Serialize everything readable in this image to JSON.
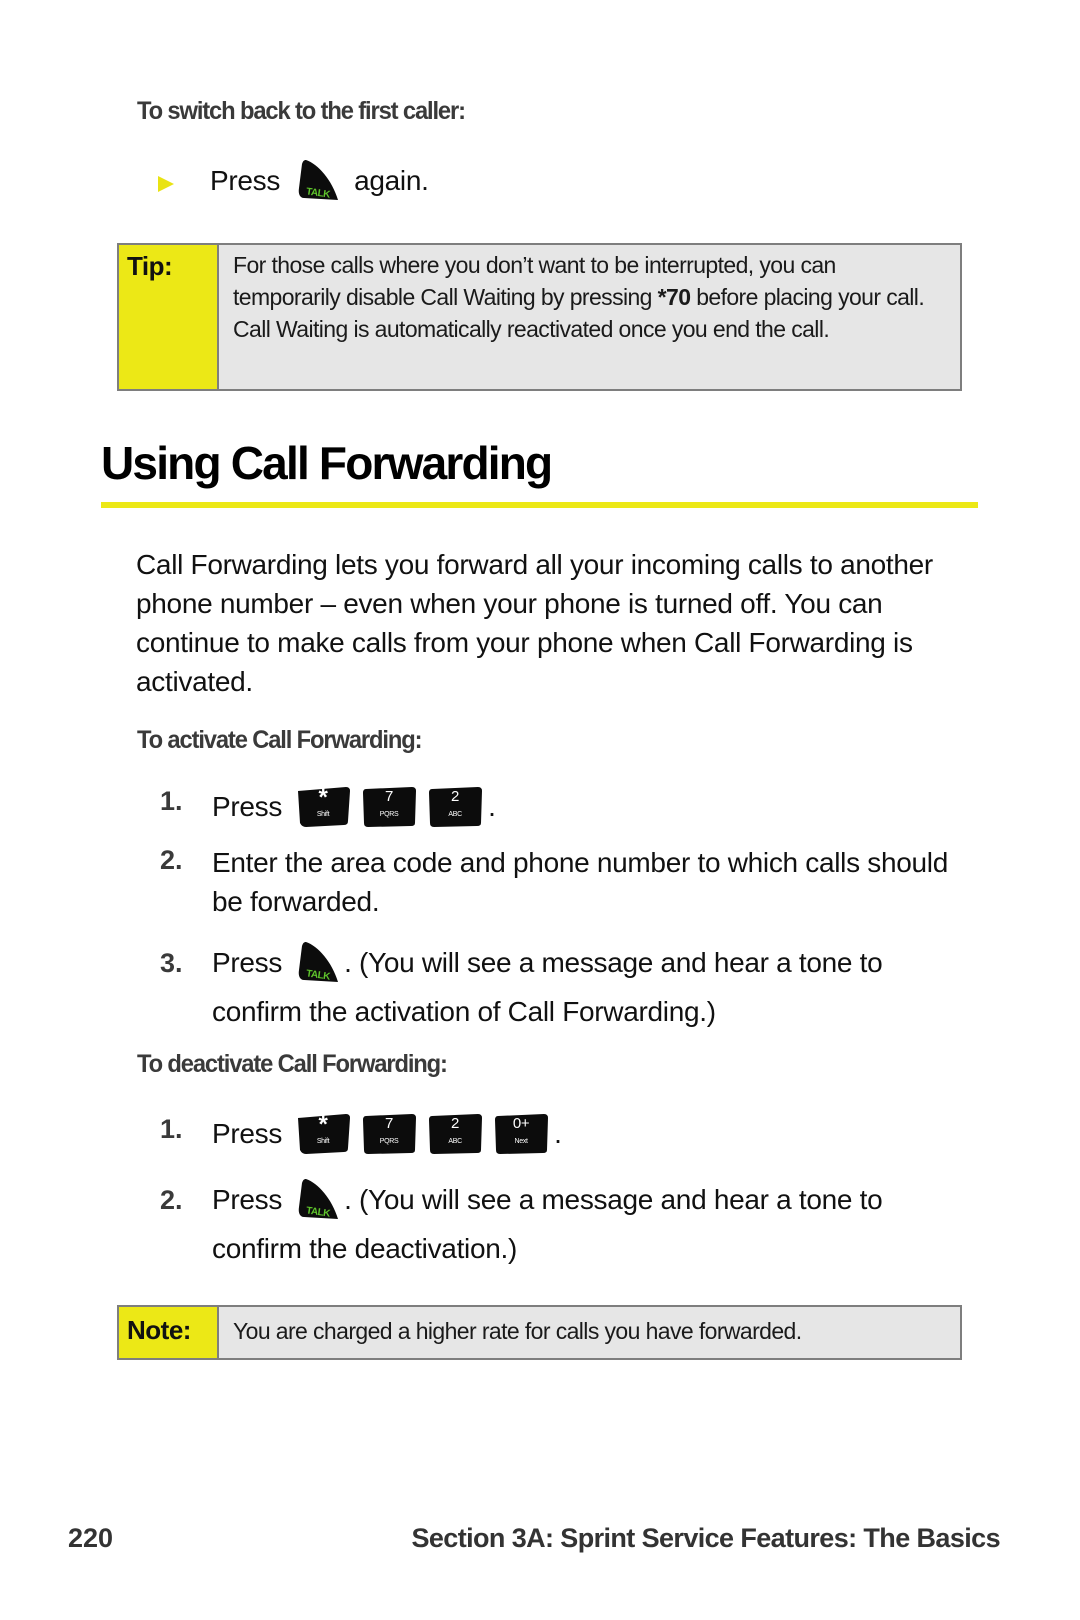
{
  "switch_back": {
    "heading": "To switch back to the first caller:",
    "bullet_prefix": "Press",
    "bullet_key": "TALK",
    "bullet_suffix": "again."
  },
  "tip": {
    "label": "Tip:",
    "text_before": "For those calls where you don’t want to be interrupted, you can temporarily disable Call Waiting by pressing ",
    "code": "*70",
    "text_after": " before placing your call. Call Waiting is automatically reactivated once you end the call."
  },
  "section": {
    "title": "Using Call Forwarding",
    "intro": "Call Forwarding lets you forward all your incoming calls to another phone number – even when your phone is turned off. You can continue to make calls from your phone when Call Forwarding is activated."
  },
  "activate": {
    "heading": "To activate Call Forwarding:",
    "steps": [
      {
        "num": "1.",
        "prefix": "Press",
        "keys": [
          {
            "main": "*",
            "sub": "Shift"
          },
          {
            "main": "7",
            "sub": "PQRS"
          },
          {
            "main": "2",
            "sub": "ABC"
          }
        ],
        "suffix": "."
      },
      {
        "num": "2.",
        "text": "Enter the area code and phone number to which calls should be forwarded."
      },
      {
        "num": "3.",
        "prefix": "Press",
        "key": "TALK",
        "suffix": ". (You will see a message and hear a tone to",
        "line2": "confirm the activation of Call Forwarding.)"
      }
    ]
  },
  "deactivate": {
    "heading": "To deactivate Call Forwarding:",
    "steps": [
      {
        "num": "1.",
        "prefix": "Press",
        "keys": [
          {
            "main": "*",
            "sub": "Shift"
          },
          {
            "main": "7",
            "sub": "PQRS"
          },
          {
            "main": "2",
            "sub": "ABC"
          },
          {
            "main": "0+",
            "sub": "Next"
          }
        ],
        "suffix": "."
      },
      {
        "num": "2.",
        "prefix": "Press",
        "key": "TALK",
        "suffix": ". (You will see a message and hear a tone to",
        "line2": "confirm the deactivation.)"
      }
    ]
  },
  "note": {
    "label": "Note:",
    "text": "You are charged a higher rate for calls you have forwarded."
  },
  "footer": {
    "page_number": "220",
    "section_title": "Section 3A: Sprint Service Features: The Basics"
  },
  "colors": {
    "accent_yellow": "#ece816",
    "callout_bg": "#e6e6e6",
    "talk_green": "#5fc42c"
  }
}
